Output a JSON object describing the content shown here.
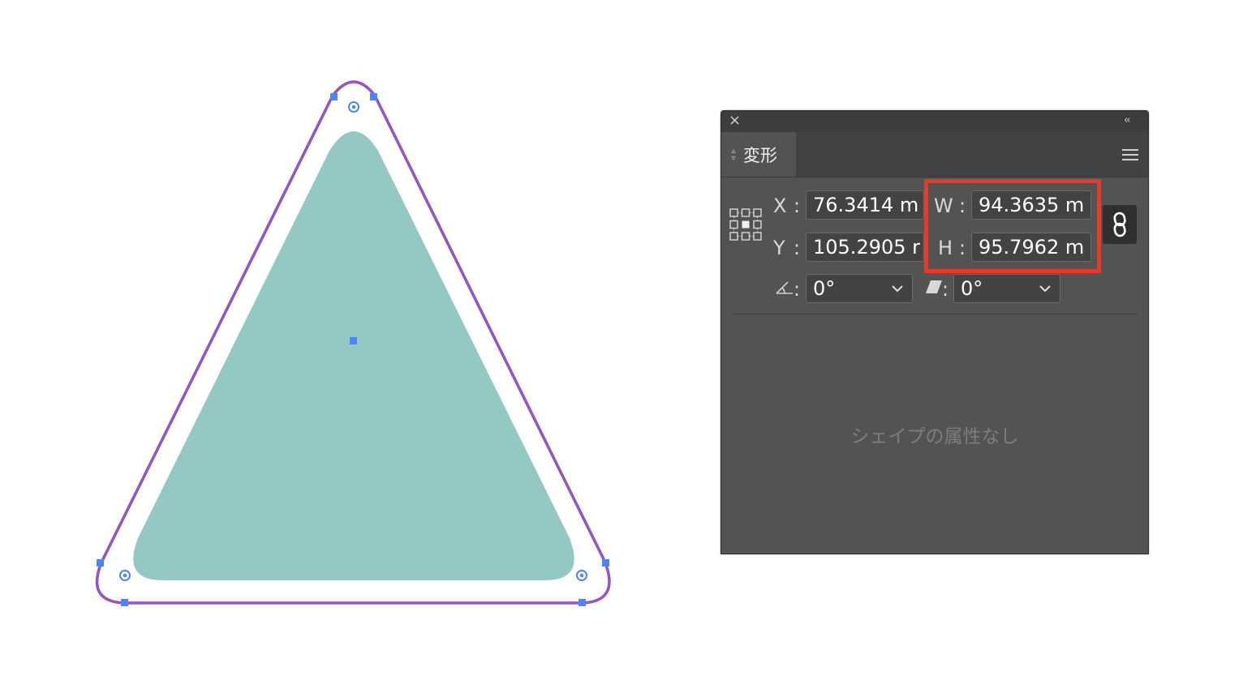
{
  "panel": {
    "tab_label": "変形",
    "fields": {
      "x": {
        "label": "X",
        "value": "76.3414 m"
      },
      "y": {
        "label": "Y",
        "value": "105.2905 r"
      },
      "w": {
        "label": "W",
        "value": "94.3635 m"
      },
      "h": {
        "label": "H",
        "value": "95.7962 m"
      },
      "angle": {
        "value": "0°"
      },
      "shear": {
        "value": "0°"
      }
    },
    "separator": ":",
    "empty_message": "シェイプの属性なし"
  },
  "colors": {
    "shape_fill": "#94c9c3",
    "outline_stroke": "#b53aa1",
    "anchor": "#4a86f7",
    "highlight": "#e8392a",
    "panel_bg": "#535353"
  },
  "icons": [
    "close-icon",
    "collapse-icon",
    "tab-arrows-icon",
    "menu-icon",
    "reference-point-icon",
    "rotate-angle-icon",
    "shear-icon",
    "chevron-down-icon",
    "link-icon"
  ]
}
